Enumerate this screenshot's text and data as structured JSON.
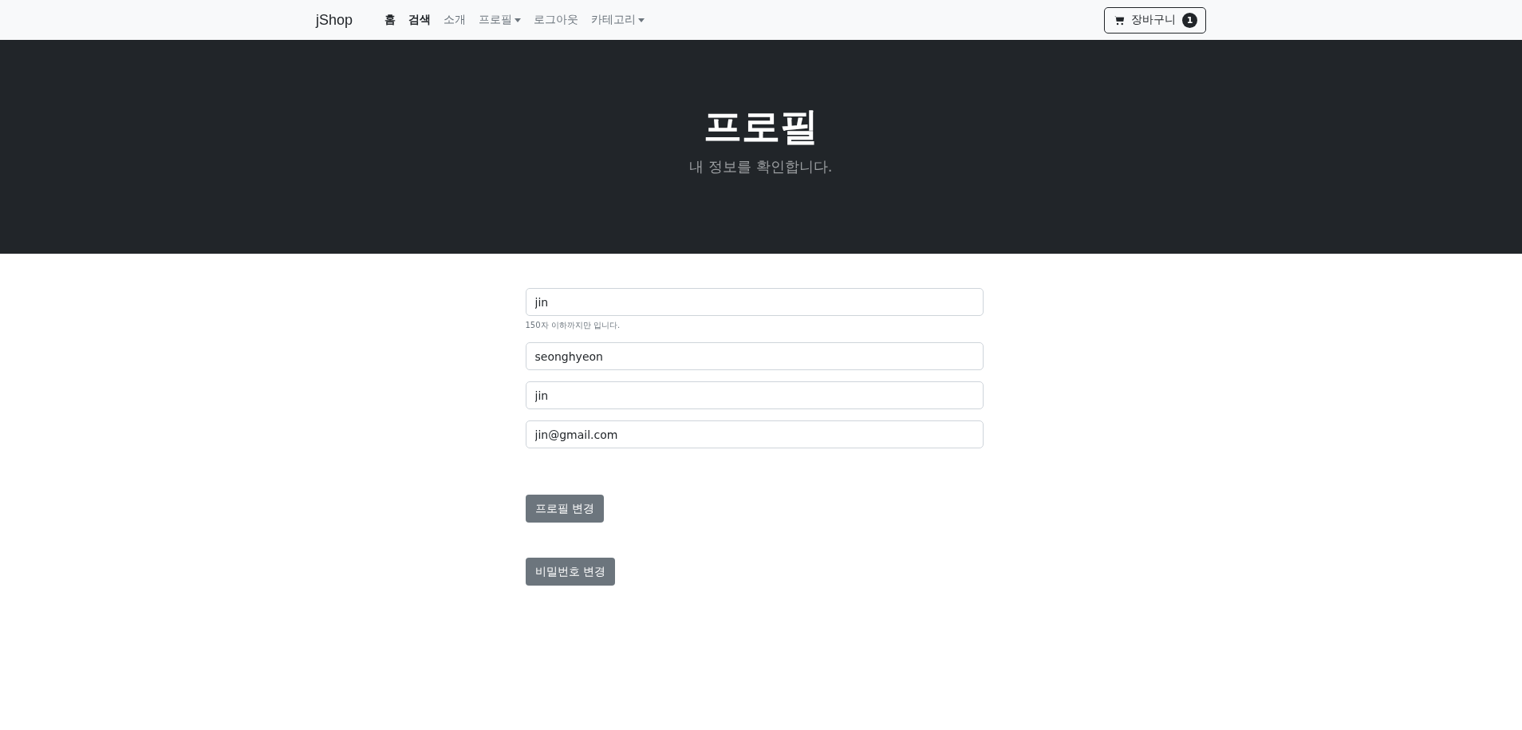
{
  "navbar": {
    "brand": "jShop",
    "items": [
      {
        "label": "홈",
        "active": true,
        "dropdown": false
      },
      {
        "label": "검색",
        "active": true,
        "dropdown": false
      },
      {
        "label": "소개",
        "active": false,
        "dropdown": false
      },
      {
        "label": "프로필",
        "active": false,
        "dropdown": true
      },
      {
        "label": "로그아웃",
        "active": false,
        "dropdown": false
      },
      {
        "label": "카테고리",
        "active": false,
        "dropdown": true
      }
    ],
    "cart": {
      "label": "장바구니",
      "count": "1"
    }
  },
  "hero": {
    "title": "프로필",
    "subtitle": "내 정보를 확인합니다."
  },
  "form": {
    "fields": [
      {
        "value": "jin",
        "help": "150자 이하까지만 입니다."
      },
      {
        "value": "seonghyeon"
      },
      {
        "value": "jin"
      },
      {
        "value": "jin@gmail.com"
      }
    ],
    "buttons": [
      "프로필 변경",
      "비밀번호 변경"
    ]
  }
}
